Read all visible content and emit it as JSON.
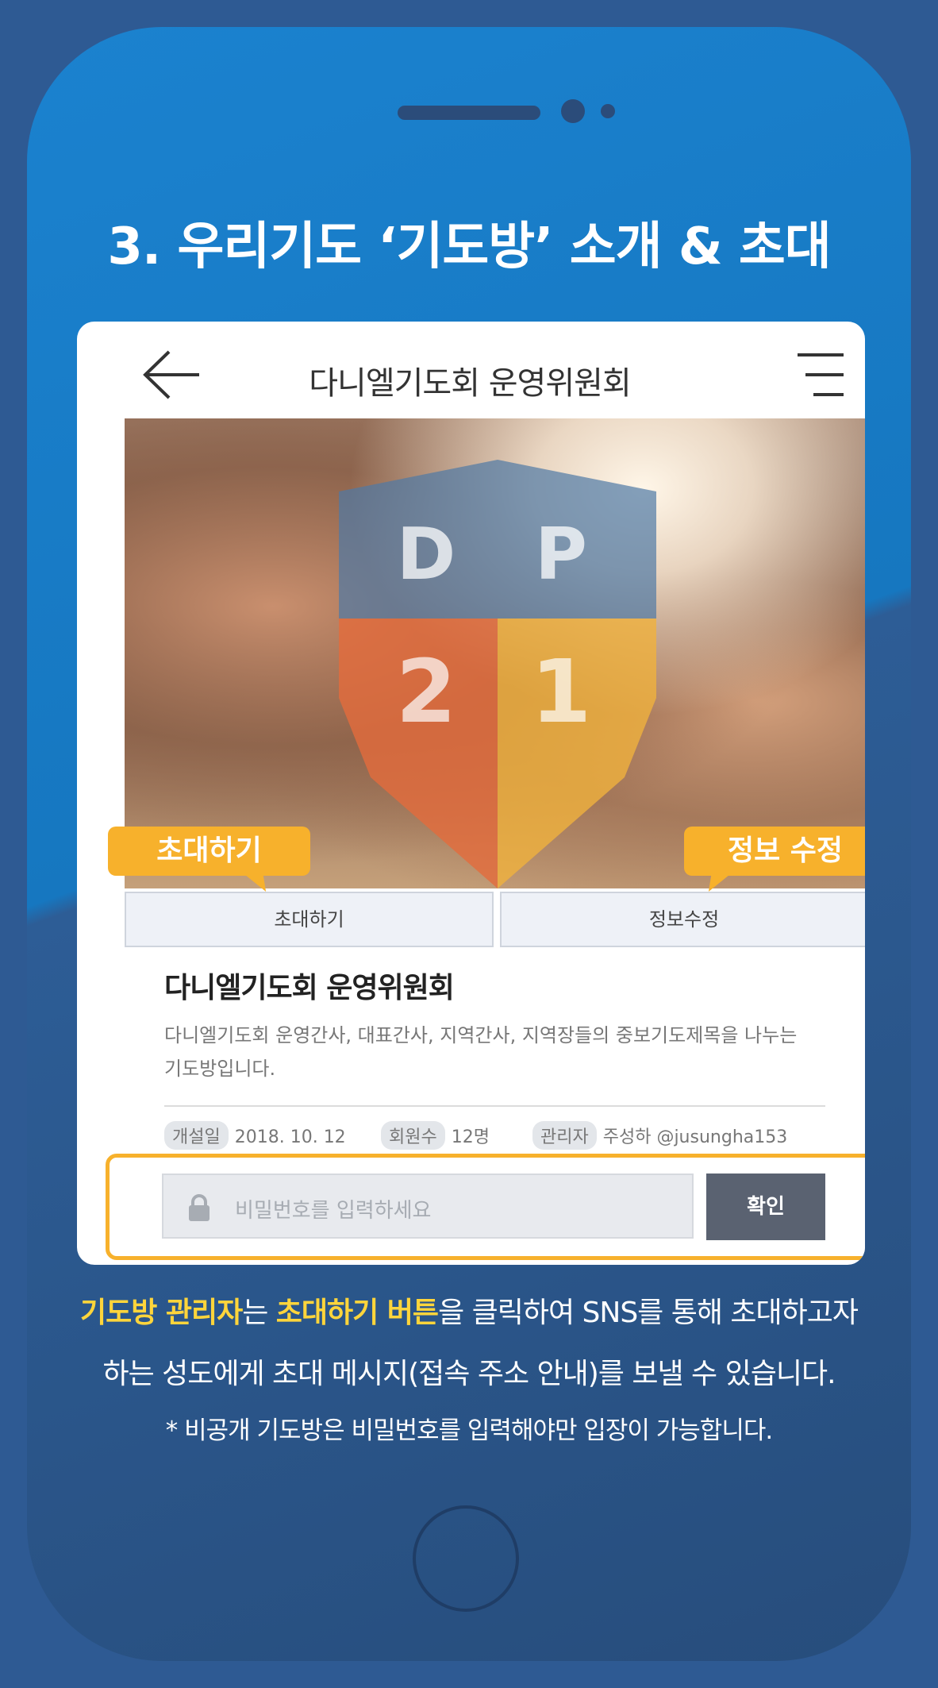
{
  "headline": "3. 우리기도 ‘기도방’ 소개 & 초대",
  "app_bar": {
    "title": "다니엘기도회 운영위원회",
    "back_icon": "arrow-left-icon",
    "menu_icon": "hamburger-menu-icon"
  },
  "hero": {
    "logo_letters": [
      "D",
      "P",
      "2",
      "1"
    ]
  },
  "tooltips": {
    "invite": "초대하기",
    "edit": "정보 수정"
  },
  "buttons": {
    "invite": "초대하기",
    "edit": "정보수정"
  },
  "room": {
    "name": "다니엘기도회 운영위원회",
    "description": "다니엘기도회 운영간사, 대표간사, 지역간사, 지역장들의 중보기도제목을 나누는 기도방입니다.",
    "meta": {
      "open_label": "개설일",
      "open_value": "2018. 10. 12",
      "members_label": "회원수",
      "members_value": "12명",
      "admin_label": "관리자",
      "admin_value": "주성하 @jusungha153"
    }
  },
  "password": {
    "placeholder": "비밀번호를 입력하세요",
    "confirm": "확인",
    "lock_icon": "lock-icon"
  },
  "caption": {
    "line1_hl1": "기도방 관리자",
    "line1_t1": "는 ",
    "line1_hl2": "초대하기 버튼",
    "line1_t2": "을 클릭하여 SNS를 통해 초대하고자",
    "line2": "하는 성도에게 초대 메시지(접속 주소 안내)를 보낼 수 있습니다.",
    "note": "* 비공개 기도방은 비밀번호를 입력해야만 입장이 가능합니다."
  },
  "colors": {
    "accent": "#f7b12c",
    "highlight": "#ffd53b",
    "phone_blue": "#1b82cf",
    "background": "#2e5a93"
  }
}
